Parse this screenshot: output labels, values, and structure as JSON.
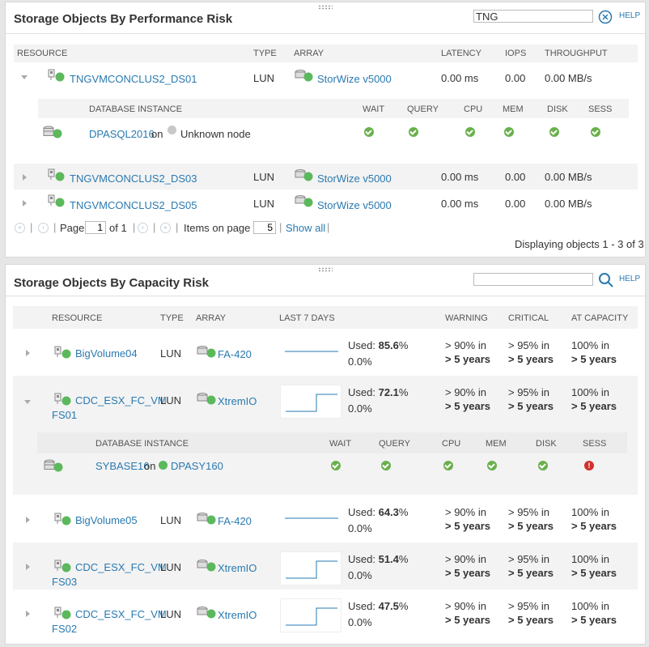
{
  "perf": {
    "title": "Storage Objects By Performance Risk",
    "search_value": "TNG",
    "help": "HELP",
    "columns": [
      "RESOURCE",
      "TYPE",
      "ARRAY",
      "LATENCY",
      "IOPS",
      "THROUGHPUT"
    ],
    "rows": [
      {
        "resource": "TNGVMCONCLUS2_DS01",
        "type": "LUN",
        "array": "StorWize v5000",
        "latency": "0.00 ms",
        "iops": "0.00",
        "throughput": "0.00 MB/s",
        "expanded": true
      },
      {
        "resource": "TNGVMCONCLUS2_DS03",
        "type": "LUN",
        "array": "StorWize v5000",
        "latency": "0.00 ms",
        "iops": "0.00",
        "throughput": "0.00 MB/s",
        "expanded": false
      },
      {
        "resource": "TNGVMCONCLUS2_DS05",
        "type": "LUN",
        "array": "StorWize v5000",
        "latency": "0.00 ms",
        "iops": "0.00",
        "throughput": "0.00 MB/s",
        "expanded": false
      }
    ],
    "sub": {
      "columns": [
        "DATABASE INSTANCE",
        "WAIT",
        "QUERY",
        "CPU",
        "MEM",
        "DISK",
        "SESS"
      ],
      "instance": "DPASQL2016",
      "on": "on",
      "node": "Unknown node",
      "statuses": [
        "ok",
        "ok",
        "ok",
        "ok",
        "ok",
        "ok"
      ]
    },
    "pager": {
      "page_label": "Page",
      "page": "1",
      "of": "of 1",
      "items_label": "Items on page",
      "items": "5",
      "show_all": "Show all",
      "display": "Displaying objects 1 - 3 of 3"
    }
  },
  "cap": {
    "title": "Storage Objects By Capacity Risk",
    "search_value": "",
    "help": "HELP",
    "columns": [
      "RESOURCE",
      "TYPE",
      "ARRAY",
      "LAST 7 DAYS",
      "WARNING",
      "CRITICAL",
      "AT CAPACITY"
    ],
    "used_label": "Used:",
    "rows": [
      {
        "name1": "BigVolume04",
        "name2": "",
        "type": "LUN",
        "array": "FA-420",
        "used": "85.6",
        "used_unit": "%",
        "delta": "0.0%",
        "warn1": "> 90% in",
        "warn2": "> 5 years",
        "crit1": "> 95% in",
        "crit2": "> 5 years",
        "cap1": "100% in",
        "cap2": "> 5 years",
        "spark": "flat"
      },
      {
        "name1": "CDC_ESX_FC_VM",
        "name2": "FS01",
        "type": "LUN",
        "array": "XtremIO",
        "used": "72.1",
        "used_unit": "%",
        "delta": "0.0%",
        "warn1": "> 90% in",
        "warn2": "> 5 years",
        "crit1": "> 95% in",
        "crit2": "> 5 years",
        "cap1": "100% in",
        "cap2": "> 5 years",
        "spark": "step"
      },
      {
        "name1": "BigVolume05",
        "name2": "",
        "type": "LUN",
        "array": "FA-420",
        "used": "64.3",
        "used_unit": "%",
        "delta": "0.0%",
        "warn1": "> 90% in",
        "warn2": "> 5 years",
        "crit1": "> 95% in",
        "crit2": "> 5 years",
        "cap1": "100% in",
        "cap2": "> 5 years",
        "spark": "flat"
      },
      {
        "name1": "CDC_ESX_FC_VM",
        "name2": "FS03",
        "type": "LUN",
        "array": "XtremIO",
        "used": "51.4",
        "used_unit": "%",
        "delta": "0.0%",
        "warn1": "> 90% in",
        "warn2": "> 5 years",
        "crit1": "> 95% in",
        "crit2": "> 5 years",
        "cap1": "100% in",
        "cap2": "> 5 years",
        "spark": "step"
      },
      {
        "name1": "CDC_ESX_FC_VM",
        "name2": "FS02",
        "type": "LUN",
        "array": "XtremIO",
        "used": "47.5",
        "used_unit": "%",
        "delta": "0.0%",
        "warn1": "> 90% in",
        "warn2": "> 5 years",
        "crit1": "> 95% in",
        "crit2": "> 5 years",
        "cap1": "100% in",
        "cap2": "> 5 years",
        "spark": "step"
      }
    ],
    "sub": {
      "columns": [
        "DATABASE INSTANCE",
        "WAIT",
        "QUERY",
        "CPU",
        "MEM",
        "DISK",
        "SESS"
      ],
      "instance": "SYBASE16",
      "on": "on",
      "node": "DPASY160",
      "statuses": [
        "ok",
        "ok",
        "ok",
        "ok",
        "ok",
        "error"
      ]
    }
  }
}
